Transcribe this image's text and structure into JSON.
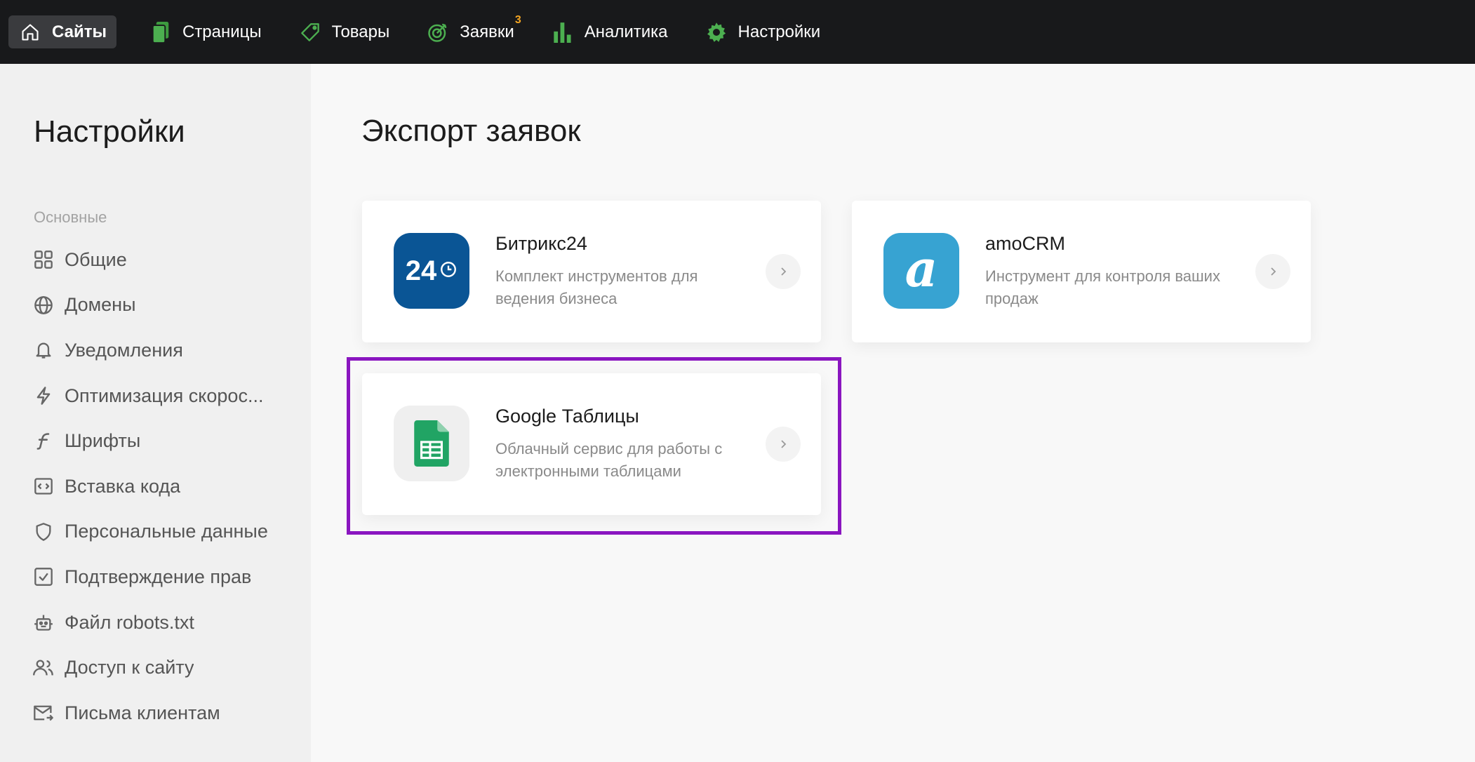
{
  "topnav": {
    "items": [
      {
        "label": "Сайты",
        "icon": "home-icon",
        "active": true
      },
      {
        "label": "Страницы",
        "icon": "pages-icon"
      },
      {
        "label": "Товары",
        "icon": "tag-icon"
      },
      {
        "label": "Заявки",
        "icon": "target-icon",
        "badge": "3"
      },
      {
        "label": "Аналитика",
        "icon": "bar-chart-icon"
      },
      {
        "label": "Настройки",
        "icon": "gear-icon"
      }
    ]
  },
  "sidebar": {
    "title": "Настройки",
    "section": "Основные",
    "items": [
      {
        "label": "Общие",
        "icon": "grid-icon"
      },
      {
        "label": "Домены",
        "icon": "globe-icon"
      },
      {
        "label": "Уведомления",
        "icon": "bell-icon"
      },
      {
        "label": "Оптимизация скорос...",
        "icon": "lightning-icon"
      },
      {
        "label": "Шрифты",
        "icon": "font-icon"
      },
      {
        "label": "Вставка кода",
        "icon": "code-icon"
      },
      {
        "label": "Персональные данные",
        "icon": "shield-icon"
      },
      {
        "label": "Подтверждение прав",
        "icon": "checkbox-icon"
      },
      {
        "label": "Файл robots.txt",
        "icon": "robot-icon"
      },
      {
        "label": "Доступ к сайту",
        "icon": "users-icon"
      },
      {
        "label": "Письма клиентам",
        "icon": "mail-icon"
      }
    ]
  },
  "main": {
    "title": "Экспорт заявок",
    "cards": [
      {
        "title": "Битрикс24",
        "description": "Комплект инструментов для ведения бизнеса",
        "logo_text": "24",
        "logo_color": "#0a5595"
      },
      {
        "title": "amoCRM",
        "description": "Инструмент для контроля ваших продаж",
        "logo_text": "a",
        "logo_color": "#37a3d2"
      },
      {
        "title": "Google Таблицы",
        "description": "Облачный сервис для работы с электронными таблицами",
        "logo_color": "#21a464"
      }
    ]
  },
  "colors": {
    "highlight": "#8a16c0",
    "accent_green": "#4caf50",
    "badge": "#f5a623"
  }
}
